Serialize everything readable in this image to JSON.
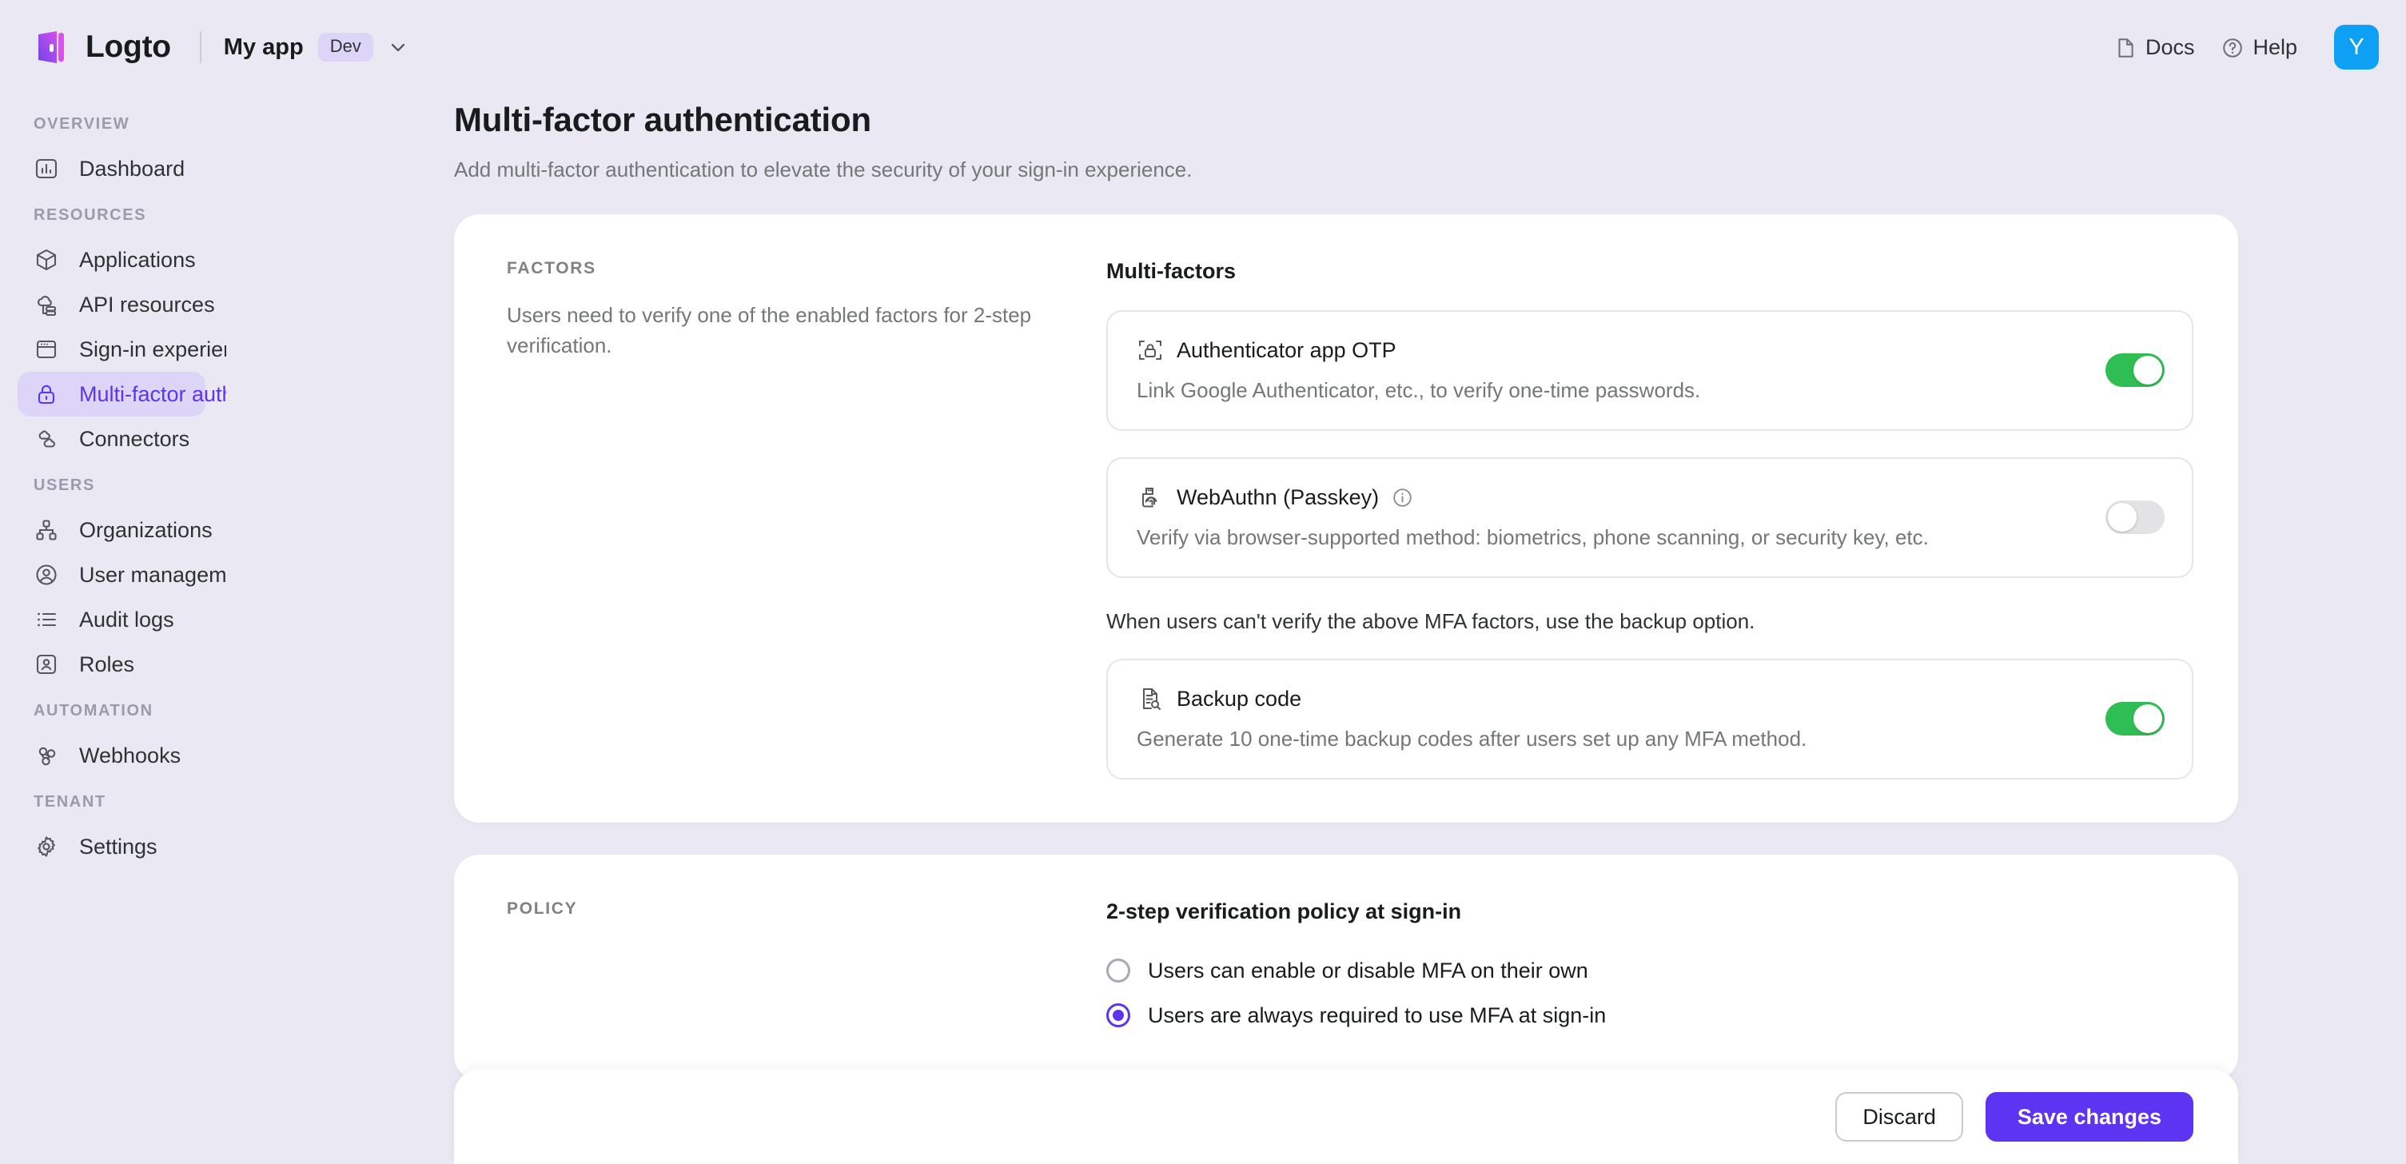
{
  "topbar": {
    "logo_icon": "logto-logo-icon",
    "brand": "Logto",
    "tenant_name": "My app",
    "tenant_badge": "Dev",
    "tenant_chevron_icon": "chevron-down-icon",
    "docs_icon": "document-icon",
    "docs_label": "Docs",
    "help_icon": "question-circle-icon",
    "help_label": "Help",
    "avatar_initial": "Y",
    "avatar_color": "#0ea0f5"
  },
  "sidebar": {
    "sections": [
      {
        "title": "OVERVIEW",
        "items": [
          {
            "label": "Dashboard",
            "icon": "dashboard-chart-icon",
            "active": false
          }
        ]
      },
      {
        "title": "RESOURCES",
        "items": [
          {
            "label": "Applications",
            "icon": "cube-icon",
            "active": false
          },
          {
            "label": "API resources",
            "icon": "api-cloud-icon",
            "active": false
          },
          {
            "label": "Sign-in experience",
            "icon": "browser-window-icon",
            "active": false
          },
          {
            "label": "Multi-factor auth",
            "icon": "lock-icon",
            "active": true
          },
          {
            "label": "Connectors",
            "icon": "connectors-cloud-icon",
            "active": false
          }
        ]
      },
      {
        "title": "USERS",
        "items": [
          {
            "label": "Organizations",
            "icon": "org-tree-icon",
            "active": false
          },
          {
            "label": "User management",
            "icon": "user-circle-icon",
            "active": false
          },
          {
            "label": "Audit logs",
            "icon": "list-icon",
            "active": false
          },
          {
            "label": "Roles",
            "icon": "user-card-icon",
            "active": false
          }
        ]
      },
      {
        "title": "AUTOMATION",
        "items": [
          {
            "label": "Webhooks",
            "icon": "webhook-icon",
            "active": false
          }
        ]
      },
      {
        "title": "TENANT",
        "items": [
          {
            "label": "Settings",
            "icon": "gear-icon",
            "active": false
          }
        ]
      }
    ]
  },
  "page": {
    "title": "Multi-factor authentication",
    "subtitle": "Add multi-factor authentication to elevate the security of your sign-in experience."
  },
  "factors_card": {
    "section_title": "FACTORS",
    "section_desc": "Users need to verify one of the enabled factors for 2-step verification.",
    "heading": "Multi-factors",
    "items": [
      {
        "name": "Authenticator app OTP",
        "description": "Link Google Authenticator, etc., to verify one-time passwords.",
        "icon": "authenticator-scan-lock-icon",
        "enabled": true,
        "has_info": false
      },
      {
        "name": "WebAuthn (Passkey)",
        "description": "Verify via browser-supported method: biometrics, phone scanning, or security key, etc.",
        "icon": "security-key-fingerprint-icon",
        "enabled": false,
        "has_info": true,
        "info_icon": "info-circle-icon"
      }
    ],
    "backup_note": "When users can't verify the above MFA factors, use the backup option.",
    "backup": {
      "name": "Backup code",
      "description": "Generate 10 one-time backup codes after users set up any MFA method.",
      "icon": "document-search-icon",
      "enabled": true,
      "has_info": false
    },
    "toggle_on_color": "#2fbe53",
    "toggle_off_color": "#e3e3e6"
  },
  "policy_card": {
    "section_title": "POLICY",
    "heading": "2-step verification policy at sign-in",
    "options": [
      {
        "label": "Users can enable or disable MFA on their own",
        "selected": false
      },
      {
        "label": "Users are always required to use MFA at sign-in",
        "selected": true
      }
    ],
    "accent_color": "#5d34f2"
  },
  "bottom_bar": {
    "discard_label": "Discard",
    "save_label": "Save changes",
    "primary_color": "#5d34f2"
  }
}
